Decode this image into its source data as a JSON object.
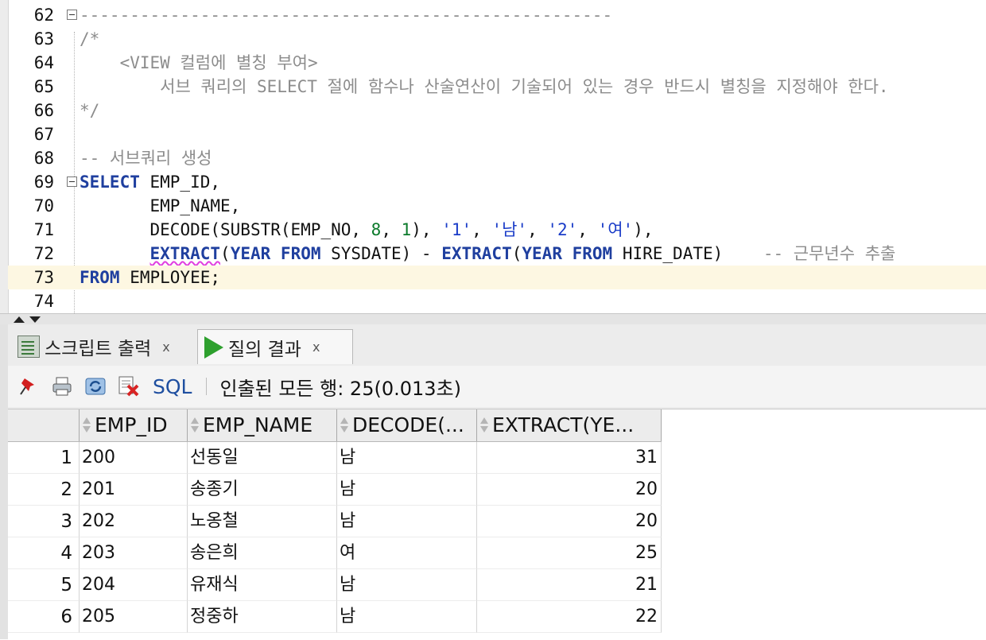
{
  "editor": {
    "lines": [
      {
        "no": "62",
        "dashes": "-----------------------------------------------------"
      },
      {
        "no": "63",
        "text": "/*"
      },
      {
        "no": "64",
        "text": "    <VIEW 컬럼에 별칭 부여>"
      },
      {
        "no": "65",
        "text": "        서브 쿼리의 SELECT 절에 함수나 산술연산이 기술되어 있는 경우 반드시 별칭을 지정해야 한다."
      },
      {
        "no": "66",
        "text": "*/"
      },
      {
        "no": "67",
        "text": ""
      },
      {
        "no": "68",
        "text": "-- 서브쿼리 생성"
      },
      {
        "no": "69",
        "kw": "SELECT",
        "rest": " EMP_ID,"
      },
      {
        "no": "70",
        "text": "       EMP_NAME,"
      },
      {
        "no": "71"
      },
      {
        "no": "72",
        "comment": "-- 근무년수 추출"
      },
      {
        "no": "73",
        "kw": "FROM",
        "rest": " EMPLOYEE;"
      },
      {
        "no": "74",
        "text": ""
      }
    ],
    "line71": {
      "indent": "       ",
      "fn": "DECODE(SUBSTR(EMP_NO, ",
      "n1": "8",
      "sep1": ", ",
      "n2": "1",
      "sep2": "), ",
      "s1": "'1'",
      "sep3": ", ",
      "s2": "'남'",
      "sep4": ", ",
      "s3": "'2'",
      "sep5": ", ",
      "s4": "'여'",
      "end": "),"
    },
    "line72": {
      "indent": "       ",
      "kw1": "EXTRACT",
      "p1": "(",
      "kw2": "YEAR",
      "sp1": " ",
      "kw3": "FROM",
      "arg1": " SYSDATE) - ",
      "kw4": "EXTRACT",
      "p2": "(",
      "kw5": "YEAR",
      "sp2": " ",
      "kw6": "FROM",
      "arg2": " HIRE_DATE)",
      "gap": "    "
    }
  },
  "panel": {
    "tabs": [
      {
        "label": "스크립트 출력",
        "close": "x"
      },
      {
        "label": "질의 결과",
        "close": "x"
      }
    ],
    "toolbar": {
      "sql_label": "SQL",
      "status": "인출된 모든 행: 25(0.013초)"
    },
    "grid": {
      "columns": [
        "EMP_ID",
        "EMP_NAME",
        "DECODE(...",
        "EXTRACT(YE..."
      ],
      "rows": [
        [
          "1",
          "200",
          "선동일",
          "남",
          "31"
        ],
        [
          "2",
          "201",
          "송종기",
          "남",
          "20"
        ],
        [
          "3",
          "202",
          "노옹철",
          "남",
          "20"
        ],
        [
          "4",
          "203",
          "송은희",
          "여",
          "25"
        ],
        [
          "5",
          "204",
          "유재식",
          "남",
          "21"
        ],
        [
          "6",
          "205",
          "정중하",
          "남",
          "22"
        ]
      ]
    }
  }
}
